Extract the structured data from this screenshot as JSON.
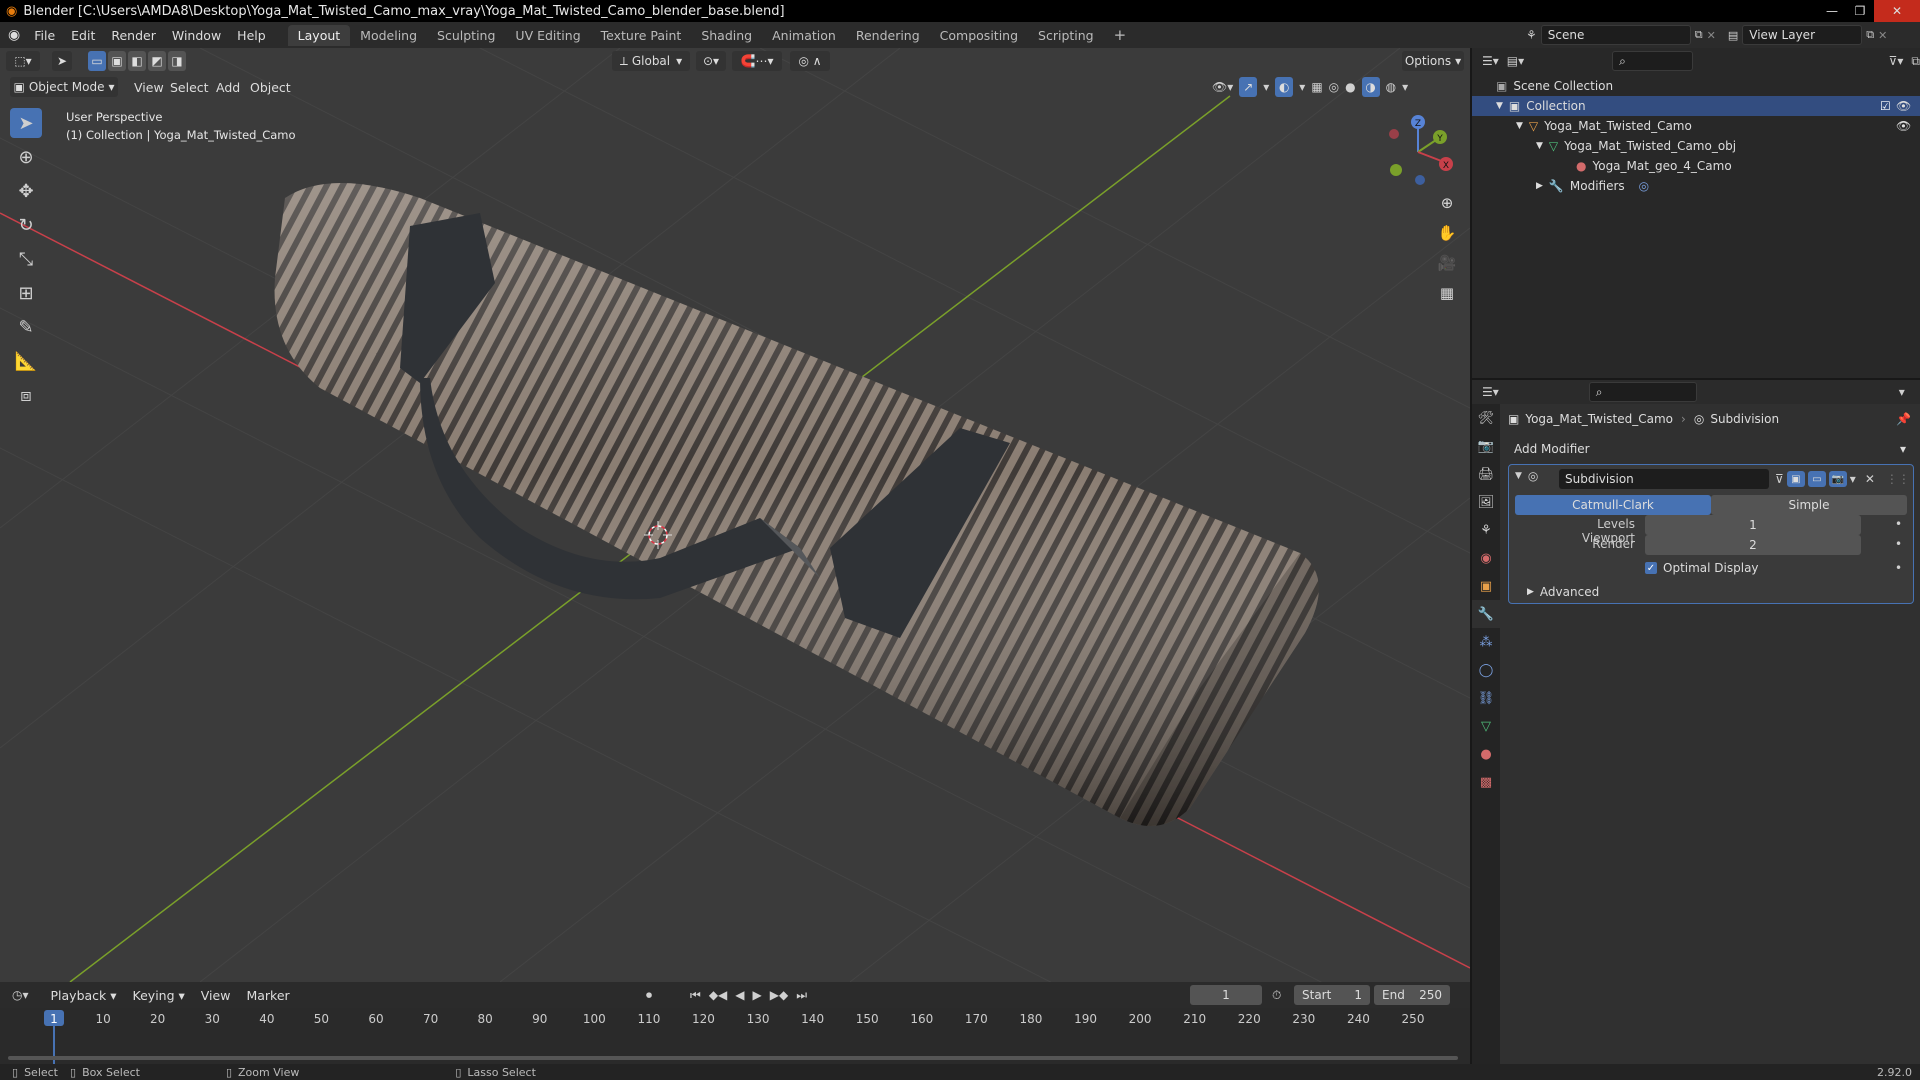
{
  "window": {
    "title": "Blender [C:\\Users\\AMDA8\\Desktop\\Yoga_Mat_Twisted_Camo_max_vray\\Yoga_Mat_Twisted_Camo_blender_base.blend]"
  },
  "menu": [
    "File",
    "Edit",
    "Render",
    "Window",
    "Help"
  ],
  "workspaces": [
    "Layout",
    "Modeling",
    "Sculpting",
    "UV Editing",
    "Texture Paint",
    "Shading",
    "Animation",
    "Rendering",
    "Compositing",
    "Scripting"
  ],
  "active_workspace": "Layout",
  "scene": "Scene",
  "view_layer": "View Layer",
  "viewport": {
    "transform_orientation": "Global",
    "options": "Options",
    "mode": "Object Mode",
    "menus": [
      "View",
      "Select",
      "Add",
      "Object"
    ],
    "overlay_line1": "User Perspective",
    "overlay_line2": "(1) Collection | Yoga_Mat_Twisted_Camo",
    "gizmo": {
      "z": "Z",
      "y": "Y",
      "x": "X"
    }
  },
  "outliner": {
    "root": "Scene Collection",
    "collection": "Collection",
    "object": "Yoga_Mat_Twisted_Camo",
    "mesh": "Yoga_Mat_Twisted_Camo_obj",
    "material": "Yoga_Mat_geo_4_Camo",
    "modifiers": "Modifiers"
  },
  "properties": {
    "object_name": "Yoga_Mat_Twisted_Camo",
    "modifier_crumb": "Subdivision",
    "add_modifier": "Add Modifier",
    "modifier_name": "Subdivision",
    "algo_catmull": "Catmull-Clark",
    "algo_simple": "Simple",
    "levels_viewport_label": "Levels Viewport",
    "levels_viewport": "1",
    "render_label": "Render",
    "render_value": "2",
    "optimal_display": "Optimal Display",
    "advanced": "Advanced"
  },
  "timeline": {
    "menus": [
      "Playback",
      "Keying",
      "View",
      "Marker"
    ],
    "current_frame": "1",
    "start_label": "Start",
    "start": "1",
    "end_label": "End",
    "end": "250",
    "ticks": [
      "1",
      "10",
      "20",
      "30",
      "40",
      "50",
      "60",
      "70",
      "80",
      "90",
      "100",
      "110",
      "120",
      "130",
      "140",
      "150",
      "160",
      "170",
      "180",
      "190",
      "200",
      "210",
      "220",
      "230",
      "240",
      "250"
    ]
  },
  "status": {
    "select": "Select",
    "box_select": "Box Select",
    "zoom_view": "Zoom View",
    "lasso_select": "Lasso Select",
    "version": "2.92.0"
  },
  "colors": {
    "accent": "#4772b3",
    "x_axis": "#c8404a",
    "y_axis": "#7aa02a",
    "bg": "#3b3b3b"
  }
}
